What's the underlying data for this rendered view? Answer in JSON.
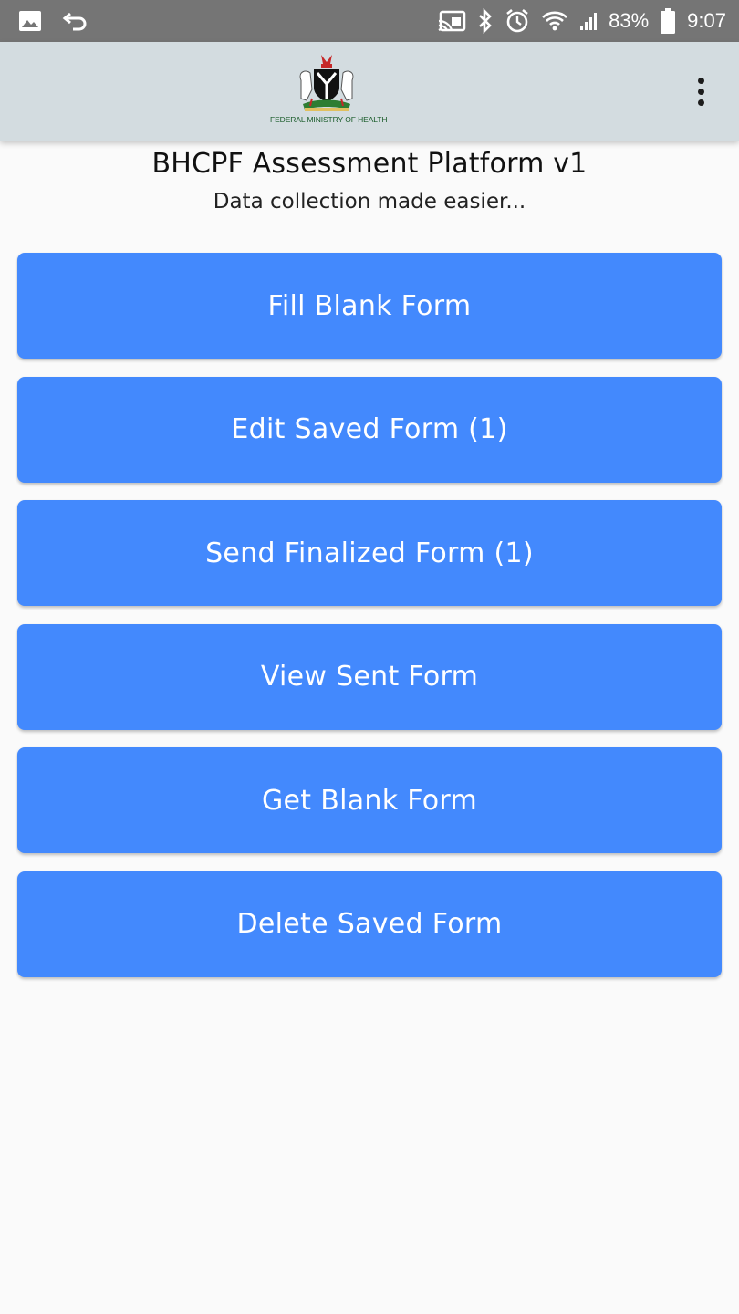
{
  "status_bar": {
    "battery_percent": "83%",
    "time": "9:07",
    "icons": [
      "image-icon",
      "undo-icon",
      "cast-icon",
      "bluetooth-icon",
      "alarm-icon",
      "wifi-icon",
      "signal-icon",
      "battery-icon"
    ]
  },
  "app_bar": {
    "logo_caption": "FEDERAL MINISTRY OF HEALTH",
    "menu_icon": "more-vert-icon"
  },
  "header": {
    "title": "BHCPF Assessment Platform v1",
    "subtitle": "Data collection made easier..."
  },
  "actions": [
    {
      "label": "Fill Blank Form"
    },
    {
      "label": "Edit Saved Form (1)"
    },
    {
      "label": "Send Finalized Form (1)"
    },
    {
      "label": "View Sent Form"
    },
    {
      "label": "Get Blank Form"
    },
    {
      "label": "Delete Saved Form"
    }
  ],
  "colors": {
    "status_bar": "#757575",
    "app_bar": "#d3dce0",
    "button": "#4389fd",
    "background": "#fafafa"
  }
}
